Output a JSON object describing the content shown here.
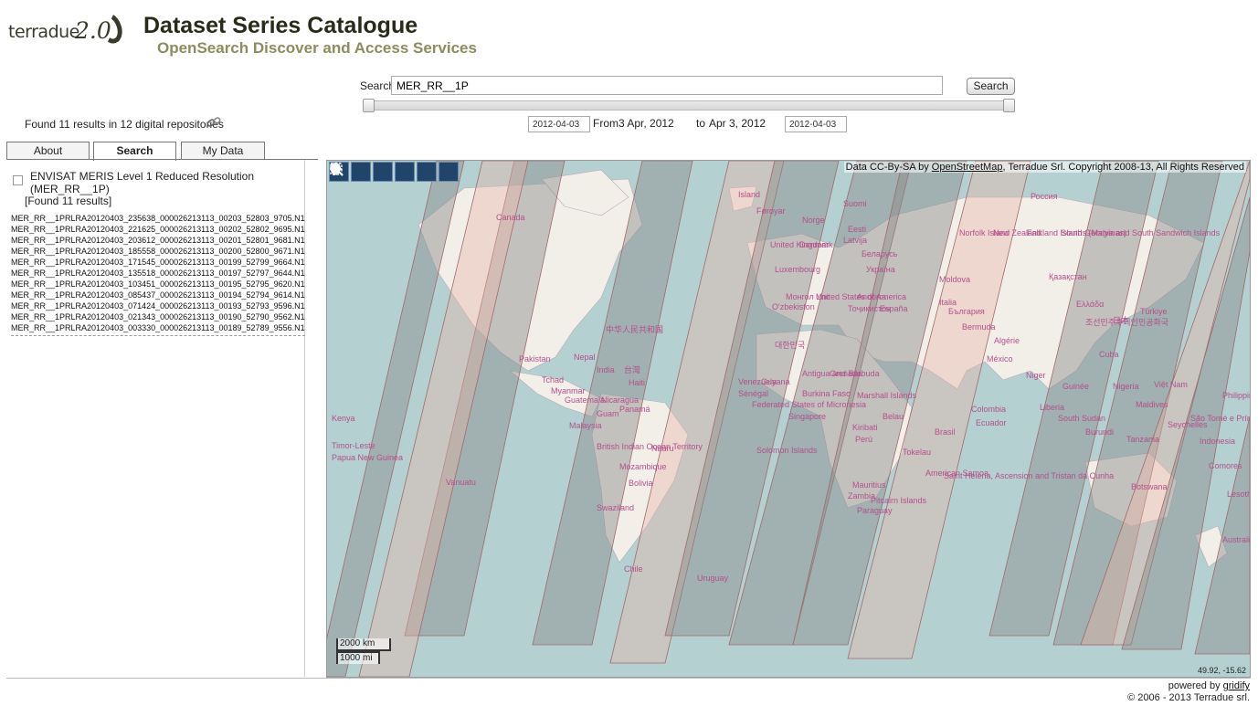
{
  "header": {
    "logo_word": "terradue",
    "logo_version": "2.0",
    "title": "Dataset Series Catalogue",
    "subtitle": "OpenSearch Discover and Access Services"
  },
  "search": {
    "label": "Search",
    "value": "MER_RR__1P",
    "button_label": "Search"
  },
  "date_range": {
    "start_value": "2012-04-03",
    "end_value": "2012-04-03",
    "from_label": "From",
    "from_date": "3 Apr, 2012",
    "to_label": "to",
    "to_date": "Apr 3, 2012"
  },
  "summary": {
    "found_text": "Found 11 results in 12 digital repositories",
    "icon": "link-icon"
  },
  "tabs": [
    {
      "label": "About",
      "active": false
    },
    {
      "label": "Search",
      "active": true
    },
    {
      "label": "My Data",
      "active": false
    }
  ],
  "series": {
    "title": "ENVISAT MERIS Level 1 Reduced Resolution (MER_RR__1P)",
    "found_count": "[Found 11 results]",
    "results": [
      "MER_RR__1PRLRA20120403_235638_000026213113_00203_52803_9705.N1",
      "MER_RR__1PRLRA20120403_221625_000026213113_00202_52802_9695.N1",
      "MER_RR__1PRLRA20120403_203612_000026213113_00201_52801_9681.N1",
      "MER_RR__1PRLRA20120403_185558_000026213113_00200_52800_9671.N1",
      "MER_RR__1PRLRA20120403_171545_000026213113_00199_52799_9664.N1",
      "MER_RR__1PRLRA20120403_135518_000026213113_00197_52797_9644.N1",
      "MER_RR__1PRLRA20120403_103451_000026213113_00195_52795_9620.N1",
      "MER_RR__1PRLRA20120403_085437_000026213113_00194_52794_9614.N1",
      "MER_RR__1PRLRA20120403_071424_000026213113_00193_52793_9596.N1",
      "MER_RR__1PRLRA20120403_021343_000026213113_00190_52790_9562.N1",
      "MER_RR__1PRLRA20120403_003330_000026213113_00189_52789_9556.N1"
    ]
  },
  "map": {
    "toolbar": [
      "home-icon",
      "pan-icon",
      "zoom-in-icon",
      "zoom-out-icon",
      "zoom-box-icon",
      "info-icon"
    ],
    "attribution_prefix": "Data CC-By-SA by ",
    "attribution_link": "OpenStreetMap",
    "attribution_suffix": ", Terradue Srl. Copyright 2008-13, All Rights Reserved",
    "scale_km": "2000 km",
    "scale_mi": "1000 mi",
    "coordinates": "49.92, -15.62",
    "colors": {
      "ocean": "#b5d0d0",
      "land": "#f2efe9",
      "swath_grey": "#8a8a8a",
      "swath_pink": "#e8b4a8"
    },
    "labels": [
      "Island",
      "Canada",
      "Føroyar",
      "Suomi",
      "Россия",
      "Norge",
      "Eesti",
      "Latvija",
      "United Kingdom",
      "Danmark",
      "Беларусь",
      "Luxembourg",
      "Україна",
      "Moldova",
      "Қазақстан",
      "Монгол Улс",
      "United States of America",
      "Andorra",
      "Italia",
      "България",
      "O'zbekiston",
      "Тоҷикистон",
      "España",
      "Ελλάδα",
      "Türkiye",
      "조선민주주의인민공화국",
      "日本",
      "中华人民共和国",
      "대한민국",
      "Bermuda",
      "Algérie",
      "Pakistan",
      "Nepal",
      "México",
      "Cuba",
      "India",
      "台灣",
      "Haiti",
      "Antigua and Barbuda",
      "Grenada",
      "Niger",
      "Tchad",
      "Myanmar",
      "Guatemala",
      "Nicaragua",
      "Panamá",
      "Venezuela",
      "Guyana",
      "Sénégal",
      "Burkina Faso",
      "Guinée",
      "Nigeria",
      "Việt Nam",
      "Philippines",
      "Guam",
      "Federated States of Micronesia",
      "Marshall Islands",
      "Colombia",
      "Liberia",
      "South Sudan",
      "Maldives",
      "Malaysia",
      "Singapore",
      "Belau",
      "Ecuador",
      "São Tomé e Príncipe",
      "Kenya",
      "British Indian Ocean Territory",
      "Nauru",
      "Kiribati",
      "Perú",
      "Brasil",
      "Burundi",
      "Tanzania",
      "Seychelles",
      "Indonesia",
      "Timor-Leste",
      "Papua New Guinea",
      "Solomon Islands",
      "Tokelau",
      "American Samoa",
      "Saint Helena, Ascension and Tristan da Cunha",
      "Comores",
      "Mozambique",
      "Mauritius",
      "Vanuatu",
      "Bolivia",
      "Zambia",
      "Pitcairn Islands",
      "Paraguay",
      "Botswana",
      "Swaziland",
      "Lesotho",
      "Australia",
      "Chile",
      "Uruguay",
      "Norfolk Island",
      "New Zealand",
      "Falkland Islands (Malvinas)",
      "South Georgia and South Sandwich Islands"
    ]
  },
  "footer": {
    "powered_prefix": "powered by ",
    "powered_link": "gridify",
    "copyright": "© 2006 - 2013 Terradue srl."
  }
}
